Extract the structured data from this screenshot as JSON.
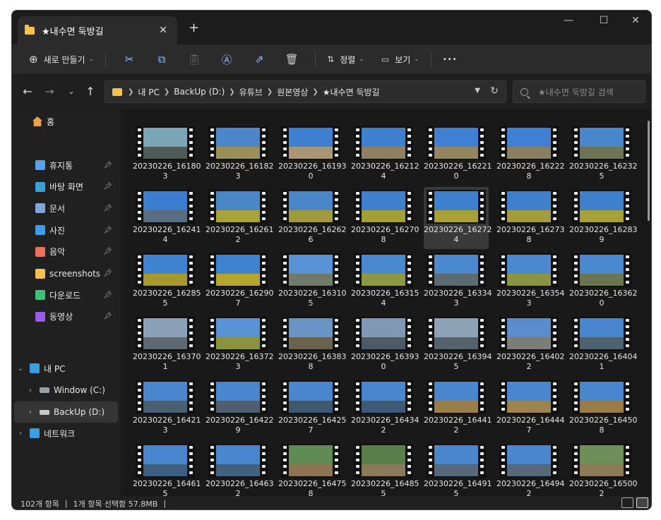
{
  "window": {
    "tab_title": "★내수면 둑방길",
    "new_tab": "+",
    "tab_close": "✕",
    "controls": {
      "minimize": "—",
      "maximize": "☐",
      "close": "✕"
    }
  },
  "toolbar": {
    "new_label": "새로 만들기",
    "sort_label": "정렬",
    "view_label": "보기",
    "more": "•••",
    "icons": [
      "cut-icon",
      "copy-icon",
      "paste-icon",
      "rename-icon",
      "share-icon",
      "delete-icon"
    ]
  },
  "address": {
    "crumbs": [
      "내 PC",
      "BackUp (D:)",
      "유튜브",
      "원본영상",
      "★내수면 둑방길"
    ],
    "search_placeholder": "★내수면 둑방길 검색"
  },
  "sidebar": {
    "home": "홈",
    "quick": [
      {
        "label": "휴지통",
        "icon": "recycle-bin-icon",
        "color": "#5aa0e8"
      },
      {
        "label": "바탕 화면",
        "icon": "desktop-icon",
        "color": "#39a0d8"
      },
      {
        "label": "문서",
        "icon": "documents-icon",
        "color": "#7fa8d8"
      },
      {
        "label": "사진",
        "icon": "pictures-icon",
        "color": "#3d9be9"
      },
      {
        "label": "음악",
        "icon": "music-icon",
        "color": "#e8735a"
      },
      {
        "label": "screenshots",
        "icon": "folder-icon",
        "color": "#f2c14e"
      },
      {
        "label": "다운로드",
        "icon": "downloads-icon",
        "color": "#3ebf7a"
      },
      {
        "label": "동영상",
        "icon": "videos-icon",
        "color": "#9a5ce6"
      }
    ],
    "this_pc": "내 PC",
    "drives": [
      {
        "label": "Window (C:)",
        "selected": false
      },
      {
        "label": "BackUp (D:)",
        "selected": true
      }
    ],
    "network": "네트워크"
  },
  "files": [
    {
      "l1": "20230226_16180",
      "l2": "3",
      "sky": "#7aa6b8",
      "ground": "#4d5a55"
    },
    {
      "l1": "20230226_16182",
      "l2": "3",
      "sky": "#4d86c8",
      "ground": "#9a8f57"
    },
    {
      "l1": "20230226_16193",
      "l2": "0",
      "sky": "#3f7fd0",
      "ground": "#a89676"
    },
    {
      "l1": "20230226_16212",
      "l2": "4",
      "sky": "#3e7fce",
      "ground": "#8f8062"
    },
    {
      "l1": "20230226_16221",
      "l2": "0",
      "sky": "#3f80d2",
      "ground": "#92855f"
    },
    {
      "l1": "20230226_16222",
      "l2": "8",
      "sky": "#3f80d2",
      "ground": "#8a7e62"
    },
    {
      "l1": "20230226_16232",
      "l2": "5",
      "sky": "#4a86cc",
      "ground": "#6d7456"
    },
    {
      "l1": "20230226_16241",
      "l2": "4",
      "sky": "#3b7ed0",
      "ground": "#5a6d80"
    },
    {
      "l1": "20230226_16261",
      "l2": "2",
      "sky": "#4a86c6",
      "ground": "#a9a23a"
    },
    {
      "l1": "20230226_16262",
      "l2": "6",
      "sky": "#4a86c6",
      "ground": "#a19a3c"
    },
    {
      "l1": "20230226_16270",
      "l2": "8",
      "sky": "#3e80cc",
      "ground": "#a59e36"
    },
    {
      "l1": "20230226_16272",
      "l2": "4",
      "sky": "#3e80cc",
      "ground": "#a8a035",
      "selected": true
    },
    {
      "l1": "20230226_16273",
      "l2": "8",
      "sky": "#3e80cc",
      "ground": "#a49c3a"
    },
    {
      "l1": "20230226_16283",
      "l2": "9",
      "sky": "#3e80cc",
      "ground": "#a6a038"
    },
    {
      "l1": "20230226_16285",
      "l2": "5",
      "sky": "#3f82cf",
      "ground": "#a69a2e"
    },
    {
      "l1": "20230226_16290",
      "l2": "7",
      "sky": "#3f82cf",
      "ground": "#b4a62e"
    },
    {
      "l1": "20230226_16310",
      "l2": "5",
      "sky": "#5a93d4",
      "ground": "#6f7a6a"
    },
    {
      "l1": "20230226_16315",
      "l2": "4",
      "sky": "#4a88d0",
      "ground": "#8e9842"
    },
    {
      "l1": "20230226_16334",
      "l2": "3",
      "sky": "#4a88d0",
      "ground": "#5c6a72"
    },
    {
      "l1": "20230226_16354",
      "l2": "3",
      "sky": "#4a88d0",
      "ground": "#8c9442"
    },
    {
      "l1": "20230226_16362",
      "l2": "0",
      "sky": "#4a88d0",
      "ground": "#6a7450"
    },
    {
      "l1": "20230226_16370",
      "l2": "1",
      "sky": "#8aa2b8",
      "ground": "#5e6870"
    },
    {
      "l1": "20230226_16372",
      "l2": "3",
      "sky": "#5a94d6",
      "ground": "#8a9240"
    },
    {
      "l1": "20230226_16383",
      "l2": "8",
      "sky": "#6a94c4",
      "ground": "#6a6350"
    },
    {
      "l1": "20230226_16393",
      "l2": "0",
      "sky": "#7e98b6",
      "ground": "#4c5966"
    },
    {
      "l1": "20230226_16394",
      "l2": "5",
      "sky": "#8ea2b6",
      "ground": "#55616c"
    },
    {
      "l1": "20230226_16402",
      "l2": "2",
      "sky": "#5a8ccc",
      "ground": "#7c7c78"
    },
    {
      "l1": "20230226_16404",
      "l2": "1",
      "sky": "#4a86ce",
      "ground": "#4f6272"
    },
    {
      "l1": "20230226_16421",
      "l2": "3",
      "sky": "#4a86ce",
      "ground": "#4b5f72"
    },
    {
      "l1": "20230226_16422",
      "l2": "9",
      "sky": "#4a86ce",
      "ground": "#4d5f6e"
    },
    {
      "l1": "20230226_16425",
      "l2": "7",
      "sky": "#4a86ce",
      "ground": "#3f5870"
    },
    {
      "l1": "20230226_16434",
      "l2": "2",
      "sky": "#4a86ce",
      "ground": "#3e5a76"
    },
    {
      "l1": "20230226_16441",
      "l2": "2",
      "sky": "#4a86ce",
      "ground": "#9a7e4a"
    },
    {
      "l1": "20230226_16444",
      "l2": "7",
      "sky": "#4a86ce",
      "ground": "#9c824c"
    },
    {
      "l1": "20230226_16450",
      "l2": "8",
      "sky": "#4a86ce",
      "ground": "#9a7c48"
    },
    {
      "l1": "20230226_16461",
      "l2": "5",
      "sky": "#4a86ce",
      "ground": "#3e5f80"
    },
    {
      "l1": "20230226_16463",
      "l2": "2",
      "sky": "#4a86ce",
      "ground": "#41617f"
    },
    {
      "l1": "20230226_16475",
      "l2": "8",
      "sky": "#5e8a54",
      "ground": "#8c7452"
    },
    {
      "l1": "20230226_16485",
      "l2": "5",
      "sky": "#5a7e4a",
      "ground": "#8a7a5a"
    },
    {
      "l1": "20230226_16491",
      "l2": "5",
      "sky": "#4a86ce",
      "ground": "#56687a"
    },
    {
      "l1": "20230226_16494",
      "l2": "2",
      "sky": "#4a86ce",
      "ground": "#56687a"
    },
    {
      "l1": "20230226_16500",
      "l2": "2",
      "sky": "#6e8e5a",
      "ground": "#8c7a56"
    }
  ],
  "status": {
    "count": "102개 항목",
    "selection": "1개 항목 선택함 57.8MB"
  }
}
